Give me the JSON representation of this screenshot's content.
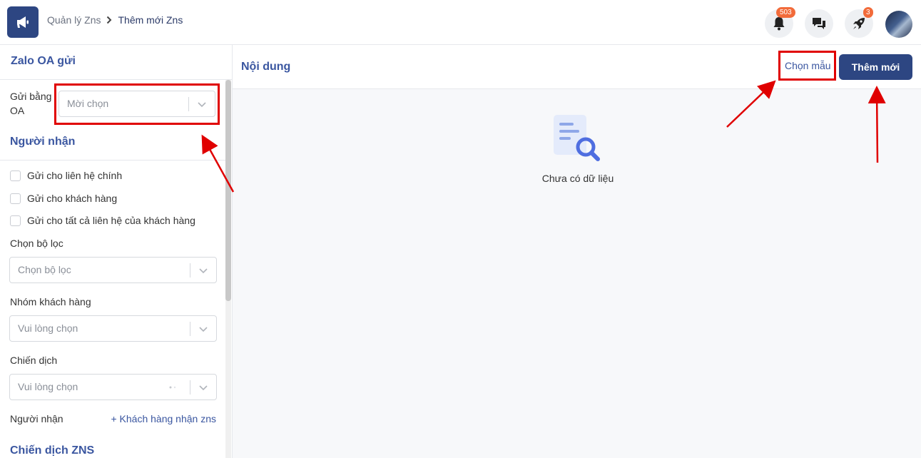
{
  "header": {
    "breadcrumb_parent": "Quản lý Zns",
    "breadcrumb_current": "Thêm mới Zns",
    "notification_count": "503",
    "rocket_count": "3"
  },
  "left_panel": {
    "title": "Zalo OA gửi",
    "send_by_oa_label": "Gửi bằng OA",
    "send_by_oa_placeholder": "Mời chọn",
    "recipient_section_title": "Người nhận",
    "checkboxes": [
      "Gửi cho liên hệ chính",
      "Gửi cho khách hàng",
      "Gửi cho tất cả liên hệ của khách hàng"
    ],
    "filter_label": "Chọn bộ lọc",
    "filter_placeholder": "Chọn bộ lọc",
    "customer_group_label": "Nhóm khách hàng",
    "customer_group_placeholder": "Vui lòng chọn",
    "campaign_label": "Chiến dịch",
    "campaign_placeholder": "Vui lòng chọn",
    "recipients_label": "Người nhận",
    "add_recipients_link": "+ Khách hàng nhận zns",
    "zns_campaign_section_title": "Chiến dịch ZNS"
  },
  "content_panel": {
    "title": "Nội dung",
    "choose_template_button": "Chọn mẫu",
    "add_new_button": "Thêm mới",
    "empty_text": "Chưa có dữ liệu"
  },
  "colors": {
    "brand": "#2d4682",
    "accent_text": "#3a56a0",
    "badge": "#f26b3a",
    "annotation": "#e00000"
  },
  "icons": [
    "megaphone-icon",
    "bell-icon",
    "chat-icon",
    "rocket-icon",
    "chevron-right-icon",
    "chevron-down-icon",
    "document-search-icon"
  ]
}
